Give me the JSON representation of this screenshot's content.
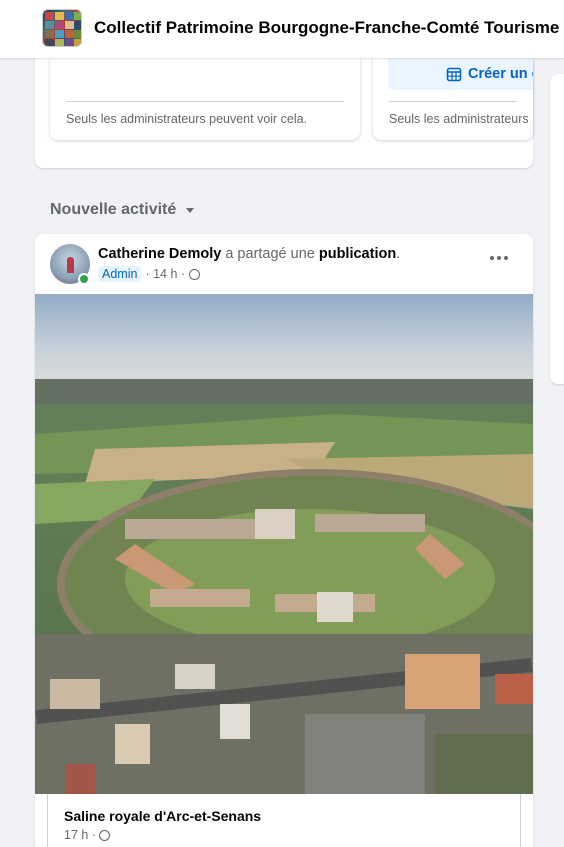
{
  "header": {
    "group_name": "Collectif Patrimoine Bourgogne-Franche-Comté Tourisme",
    "group_thumb_icon": "group-cover-thumbnail"
  },
  "top_cards": {
    "left": {
      "admin_note": "Seuls les administrateurs peuvent voir cela."
    },
    "right": {
      "create_label": "Créer un é",
      "create_icon": "calendar-icon",
      "admin_note": "Seuls les administrateurs p"
    }
  },
  "feed": {
    "section_label": "Nouvelle activité",
    "section_icon": "caret-down-icon"
  },
  "post": {
    "author": "Catherine Demoly",
    "verb": " a partagé une ",
    "object": "publication",
    "period": ".",
    "badge": "Admin",
    "time": "· 14 h ·",
    "audience_icon": "group-audience-icon",
    "more_icon": "more-options-icon",
    "shared": {
      "title": "Saline royale d'Arc-et-Senans",
      "time": "17 h ·",
      "audience_icon": "globe-icon"
    }
  },
  "colors": {
    "accent": "#0064d1",
    "background": "#f0f2f5",
    "online": "#31a24c"
  }
}
